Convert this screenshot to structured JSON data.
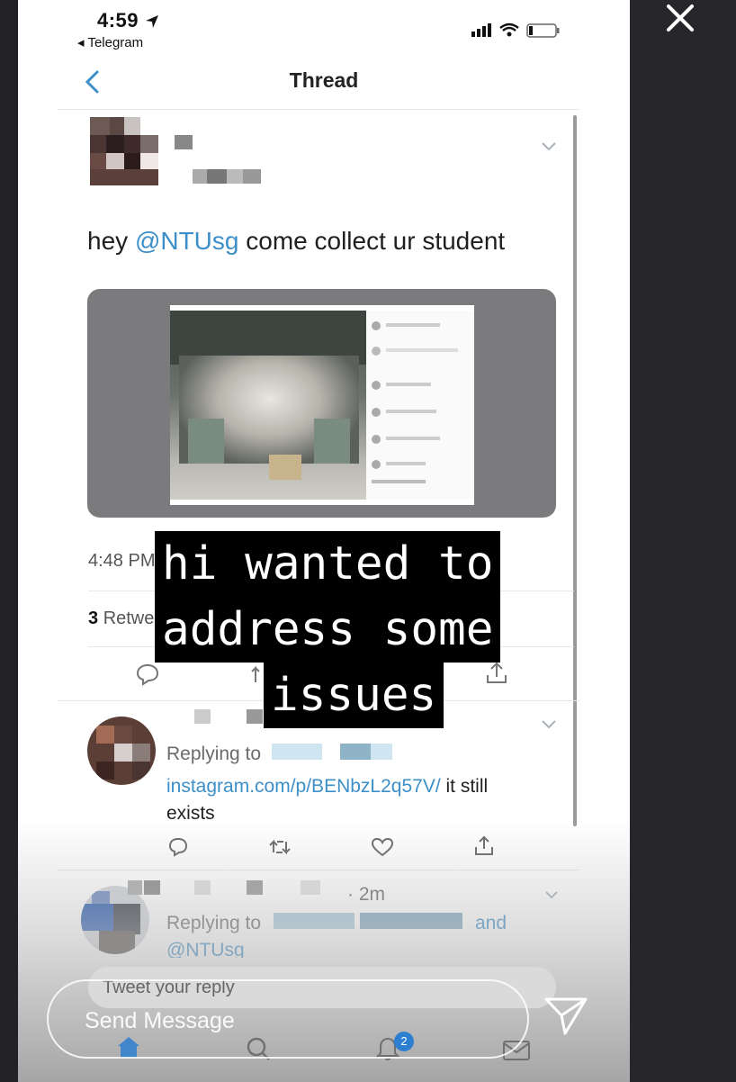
{
  "status_bar": {
    "time": "4:59",
    "back_app": "Telegram"
  },
  "nav": {
    "title": "Thread"
  },
  "tweet": {
    "text_prefix": "hey ",
    "mention": "@NTUsg",
    "text_suffix": " come collect ur student",
    "time": "4:48 PM",
    "retweets": "3",
    "retweets_label": "Retwe"
  },
  "overlay_caption": {
    "line1": "hi wanted to",
    "line2": "address some",
    "line3": "issues"
  },
  "reply1": {
    "replying_to": "Replying to",
    "link": "instagram.com/p/BENbzL2q57V/",
    "text_after": " it still",
    "text_line2": "exists"
  },
  "reply2": {
    "age": "· 2m",
    "replying_to": "Replying to",
    "and": "and",
    "mention_partial": "@NTUsg"
  },
  "composer": {
    "placeholder": "Tweet your reply"
  },
  "story_input": {
    "placeholder": "Send Message"
  },
  "tab_bar": {
    "notifications_badge": "2"
  },
  "colors": {
    "link": "#3d8fc9",
    "text": "#1f1f1f",
    "caption_bg": "#000000",
    "caption_text": "#ffffff"
  },
  "icons": [
    "close-icon",
    "back-chevron-icon",
    "chevron-down-icon",
    "reply-icon",
    "retweet-icon",
    "like-icon",
    "share-icon",
    "home-icon",
    "search-icon",
    "notifications-icon",
    "messages-icon",
    "send-arrow-icon"
  ]
}
